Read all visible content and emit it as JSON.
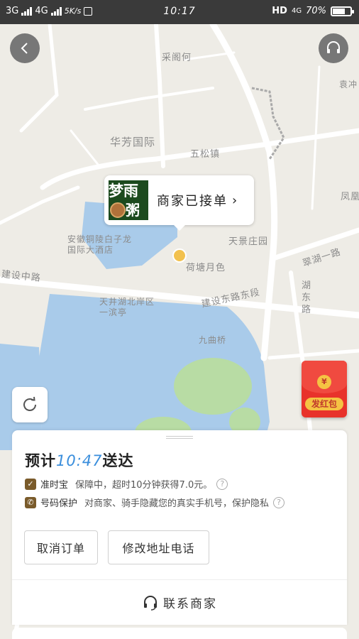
{
  "status_bar": {
    "signal1": "3G",
    "signal2": "4G",
    "speed": "5K/s",
    "time": "10:17",
    "hd": "HD",
    "net": "4G",
    "battery_text": "70%",
    "battery_level": 0.7
  },
  "map": {
    "labels": [
      {
        "id": "map-label-1",
        "text": "采阁何"
      },
      {
        "id": "map-label-2",
        "text": "华芳国际"
      },
      {
        "id": "map-label-3",
        "text": "五松镇"
      },
      {
        "id": "map-label-4",
        "text": "天景庄园"
      },
      {
        "id": "map-label-5",
        "text": "荷塘月色"
      },
      {
        "id": "map-label-6",
        "text": "建设中路"
      },
      {
        "id": "map-label-7",
        "text": "建设东路东段"
      },
      {
        "id": "map-label-8",
        "text": "翠湖一路"
      },
      {
        "id": "map-label-9",
        "text": "湖东路"
      },
      {
        "id": "map-label-10",
        "text": "安徽铜陵白子龙国际大酒店"
      },
      {
        "id": "map-label-11",
        "text": "天井湖北岸区一滨亭"
      },
      {
        "id": "map-label-12",
        "text": "九曲桥"
      },
      {
        "id": "map-label-13",
        "text": "袁冲"
      },
      {
        "id": "map-label-14",
        "text": "凤凰"
      }
    ]
  },
  "merchant": {
    "logo_line1": "梦雨",
    "logo_line2": "粥铺",
    "status": "商家已接单",
    "chevron": "›"
  },
  "redpacket": {
    "coin": "¥",
    "label": "发红包"
  },
  "order": {
    "eta_prefix": "预计",
    "eta_time": "10:47",
    "eta_suffix": "送达",
    "guarantee_title": "准时宝",
    "guarantee_desc": "保障中，超时10分钟获得7.0元。",
    "privacy_title": "号码保护",
    "privacy_desc": "对商家、骑手隐藏您的真实手机号，保护隐私",
    "cancel_label": "取消订单",
    "modify_label": "修改地址电话",
    "contact_label": "联系商家",
    "help_mark": "?"
  },
  "colors": {
    "accent": "#3a8edc",
    "map_water": "#a9cbea",
    "map_green": "#b8dca4",
    "map_bg": "#eeece6",
    "redpacket": "#e8322b"
  }
}
